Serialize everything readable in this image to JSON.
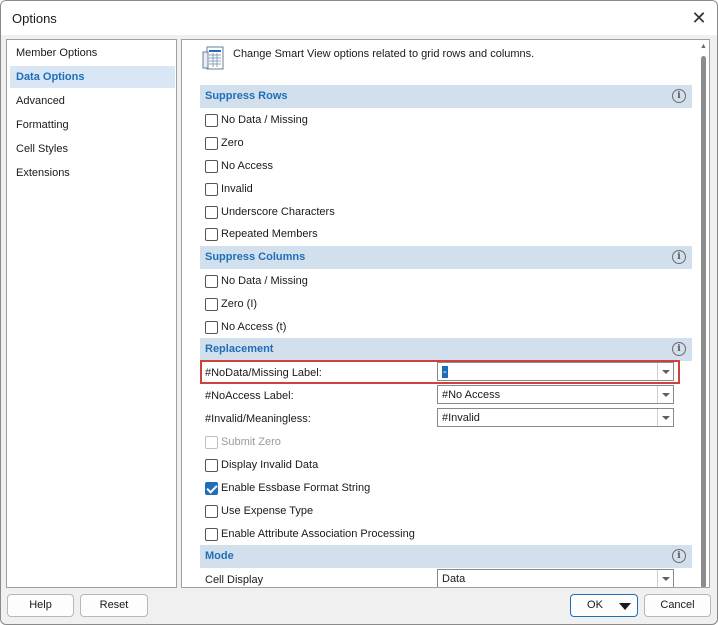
{
  "window": {
    "title": "Options"
  },
  "nav": {
    "items": [
      {
        "label": "Member Options"
      },
      {
        "label": "Data Options"
      },
      {
        "label": "Advanced"
      },
      {
        "label": "Formatting"
      },
      {
        "label": "Cell Styles"
      },
      {
        "label": "Extensions"
      }
    ],
    "selected": "Data Options"
  },
  "content": {
    "header_text": "Change Smart View options related to grid rows and columns.",
    "suppress_rows": {
      "title": "Suppress Rows",
      "options": [
        {
          "label": "No Data / Missing",
          "checked": false
        },
        {
          "label": "Zero",
          "checked": false
        },
        {
          "label": "No Access",
          "checked": false
        },
        {
          "label": "Invalid",
          "checked": false
        },
        {
          "label": "Underscore Characters",
          "checked": false
        },
        {
          "label": "Repeated Members",
          "checked": false
        }
      ]
    },
    "suppress_columns": {
      "title": "Suppress Columns",
      "options": [
        {
          "label": "No Data / Missing",
          "checked": false
        },
        {
          "label": "Zero (I)",
          "checked": false
        },
        {
          "label": "No Access (t)",
          "checked": false
        }
      ]
    },
    "replacement": {
      "title": "Replacement",
      "nodata_label": "#NoData/Missing Label:",
      "nodata_value": "-",
      "noaccess_label": "#NoAccess Label:",
      "noaccess_value": "#No Access",
      "invalid_label": "#Invalid/Meaningless:",
      "invalid_value": "#Invalid",
      "options": [
        {
          "label": "Submit Zero",
          "checked": false,
          "disabled": true
        },
        {
          "label": "Display Invalid Data",
          "checked": false
        },
        {
          "label": "Enable Essbase Format String",
          "checked": true
        },
        {
          "label": "Use Expense Type",
          "checked": false
        },
        {
          "label": "Enable Attribute Association Processing",
          "checked": false
        }
      ]
    },
    "mode": {
      "title": "Mode",
      "cell_display_label": "Cell Display",
      "cell_display_value": "Data"
    }
  },
  "footer": {
    "help_label": "Help",
    "reset_label": "Reset",
    "ok_label": "OK",
    "cancel_label": "Cancel"
  },
  "colors": {
    "accent": "#1f6fb8",
    "section_bg": "#d2dfec",
    "highlight": "#d0413b"
  }
}
